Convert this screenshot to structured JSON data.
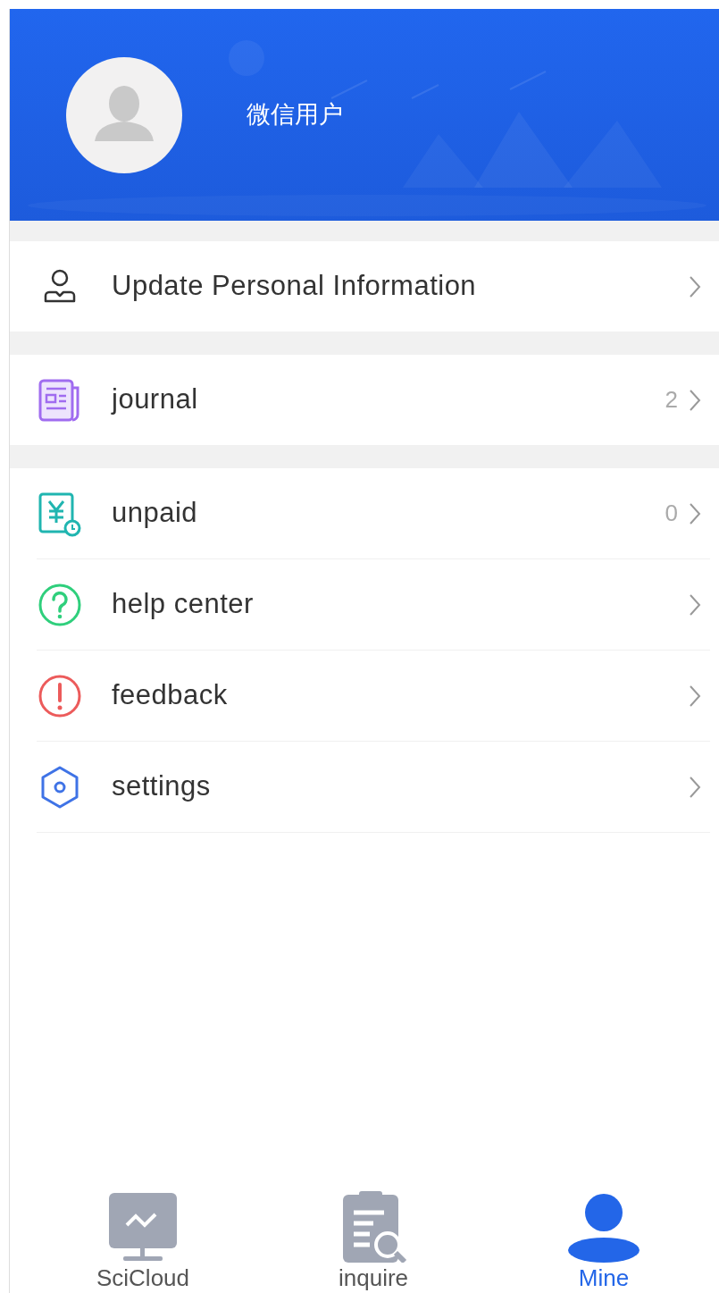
{
  "profile": {
    "name": "微信用户"
  },
  "menu_groups": [
    {
      "items": [
        {
          "kind": "person",
          "label": "Update Personal Information"
        }
      ]
    },
    {
      "items": [
        {
          "kind": "journal",
          "label": "journal",
          "count": "2"
        }
      ]
    },
    {
      "items": [
        {
          "kind": "unpaid",
          "label": "unpaid",
          "count": "0"
        },
        {
          "kind": "help",
          "label": "help center"
        },
        {
          "kind": "feedback",
          "label": "feedback"
        },
        {
          "kind": "settings",
          "label": "settings"
        }
      ]
    }
  ],
  "tabs": [
    {
      "kind": "monitor",
      "label": "SciCloud",
      "selected": false
    },
    {
      "kind": "clipboard",
      "label": "inquire",
      "selected": false
    },
    {
      "kind": "user",
      "label": "Mine",
      "selected": true
    }
  ]
}
